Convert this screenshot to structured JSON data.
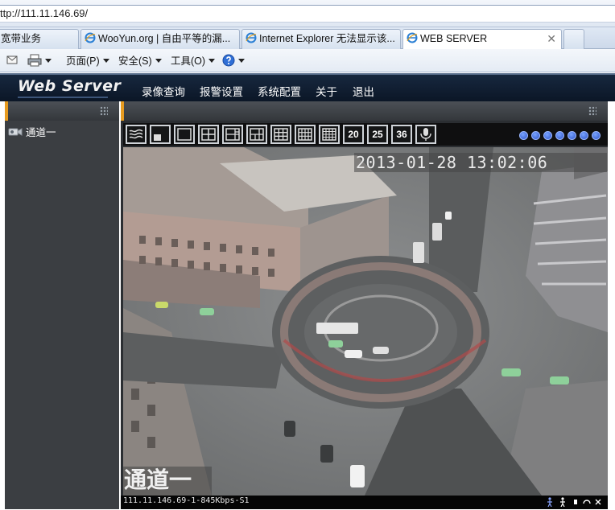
{
  "browser": {
    "address": "ttp://111.11.146.69/",
    "tabs": [
      {
        "label": "宽带业务"
      },
      {
        "label": "WooYun.org | 自由平等的漏..."
      },
      {
        "label": "Internet Explorer 无法显示该..."
      },
      {
        "label": "WEB SERVER"
      }
    ],
    "close_glyph": "✕",
    "commands": {
      "page": "页面(P)",
      "safety": "安全(S)",
      "tools": "工具(O)"
    }
  },
  "app": {
    "logo": "Web Server",
    "nav": [
      "录像查询",
      "报警设置",
      "系统配置",
      "关于",
      "退出"
    ],
    "tree": {
      "channel_label": "通道一"
    },
    "toolbar": {
      "grid_buttons": [
        "20",
        "25",
        "36"
      ]
    },
    "video": {
      "timestamp": "2013-01-28 13:02:06",
      "channel_overlay": "通道一"
    },
    "status": {
      "stream_info": "111.11.146.69-1-845Kbps-S1"
    }
  },
  "colors": {
    "header_bg": "#0b1626",
    "panel_accent": "#e79b1f",
    "panel_bg": "#3b3e42"
  }
}
